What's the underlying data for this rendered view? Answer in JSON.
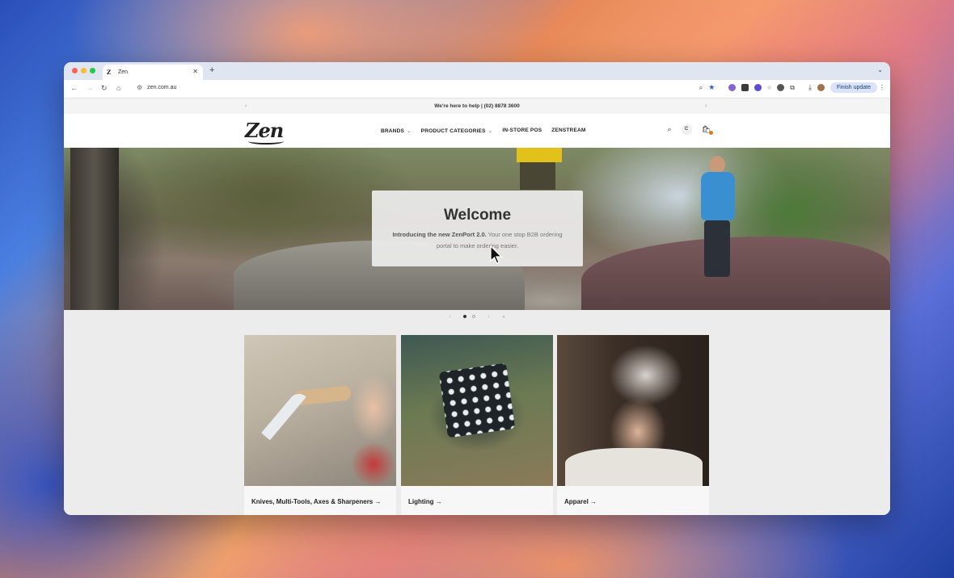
{
  "browser": {
    "tab_title": "Zen",
    "favicon_text": "Z",
    "url": "zen.com.au",
    "finish_update": "Finish update"
  },
  "announcement": {
    "text": "We're here to help | (02) 8878 3600"
  },
  "header": {
    "logo": "Zen",
    "nav": [
      {
        "label": "BRANDS",
        "dropdown": true
      },
      {
        "label": "PRODUCT CATEGORIES",
        "dropdown": true
      },
      {
        "label": "IN-STORE POS",
        "dropdown": false
      },
      {
        "label": "ZENSTREAM",
        "dropdown": false
      }
    ],
    "account_initial": "C"
  },
  "hero": {
    "title": "Welcome",
    "lead_bold": "Introducing the new ZenPort 2.0.",
    "lead_rest": " Your one stop B2B ordering portal to make ordering easier."
  },
  "slider": {
    "current": 1,
    "total": 2
  },
  "categories": [
    {
      "label": "Knives, Multi-Tools, Axes & Sharpeners →"
    },
    {
      "label": "Lighting →"
    },
    {
      "label": "Apparel →"
    }
  ],
  "colors": {
    "accent": "#e07a1f",
    "update_pill": "#d9e4fb"
  }
}
